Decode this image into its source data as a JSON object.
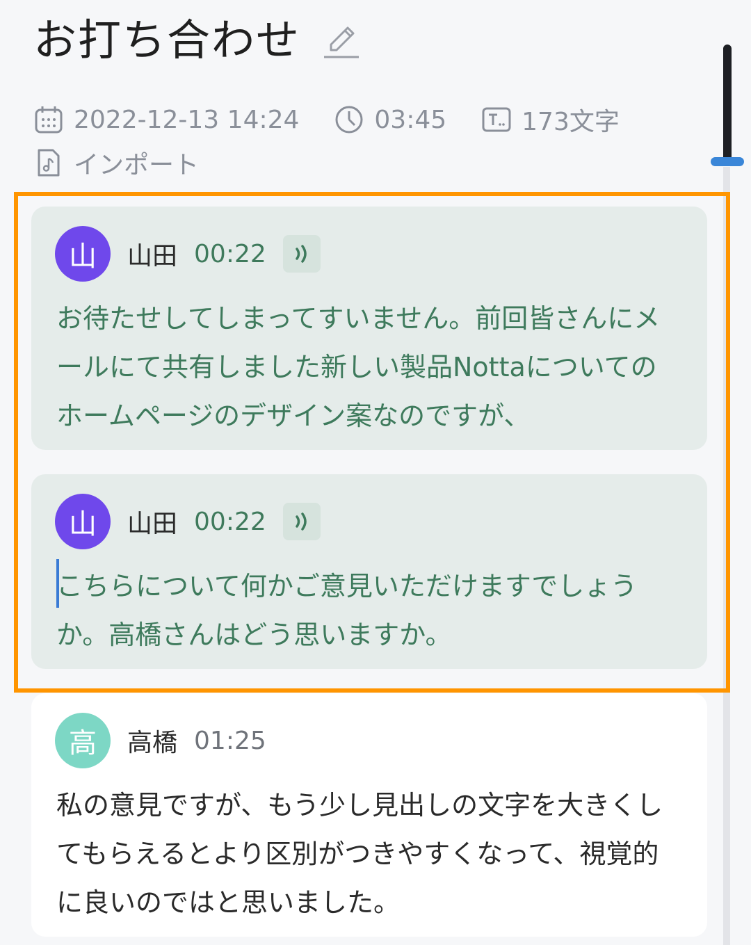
{
  "header": {
    "title": "お打ち合わせ",
    "date": "2022-12-13 14:24",
    "duration": "03:45",
    "char_count": "173文字",
    "source": "インポート"
  },
  "colors": {
    "accent": "#ff9500",
    "avatar_yamada": "#6f48eb",
    "avatar_takahashi": "#7dd7c5",
    "highlight_text": "#3e7a5c"
  },
  "transcript": [
    {
      "avatar": "山",
      "speaker": "山田",
      "time": "00:22",
      "text": "お待たせしてしまってすいません。前回皆さんにメールにて共有しました新しい製品Nottaについてのホームページのデザイン案なのですが、"
    },
    {
      "avatar": "山",
      "speaker": "山田",
      "time": "00:22",
      "text": "こちらについて何かご意見いただけますでしょうか。高橋さんはどう思いますか。"
    },
    {
      "avatar": "高",
      "speaker": "高橋",
      "time": "01:25",
      "text": "私の意見ですが、もう少し見出しの文字を大きくしてもらえるとより区別がつきやすくなって、視覚的に良いのではと思いました。"
    }
  ]
}
